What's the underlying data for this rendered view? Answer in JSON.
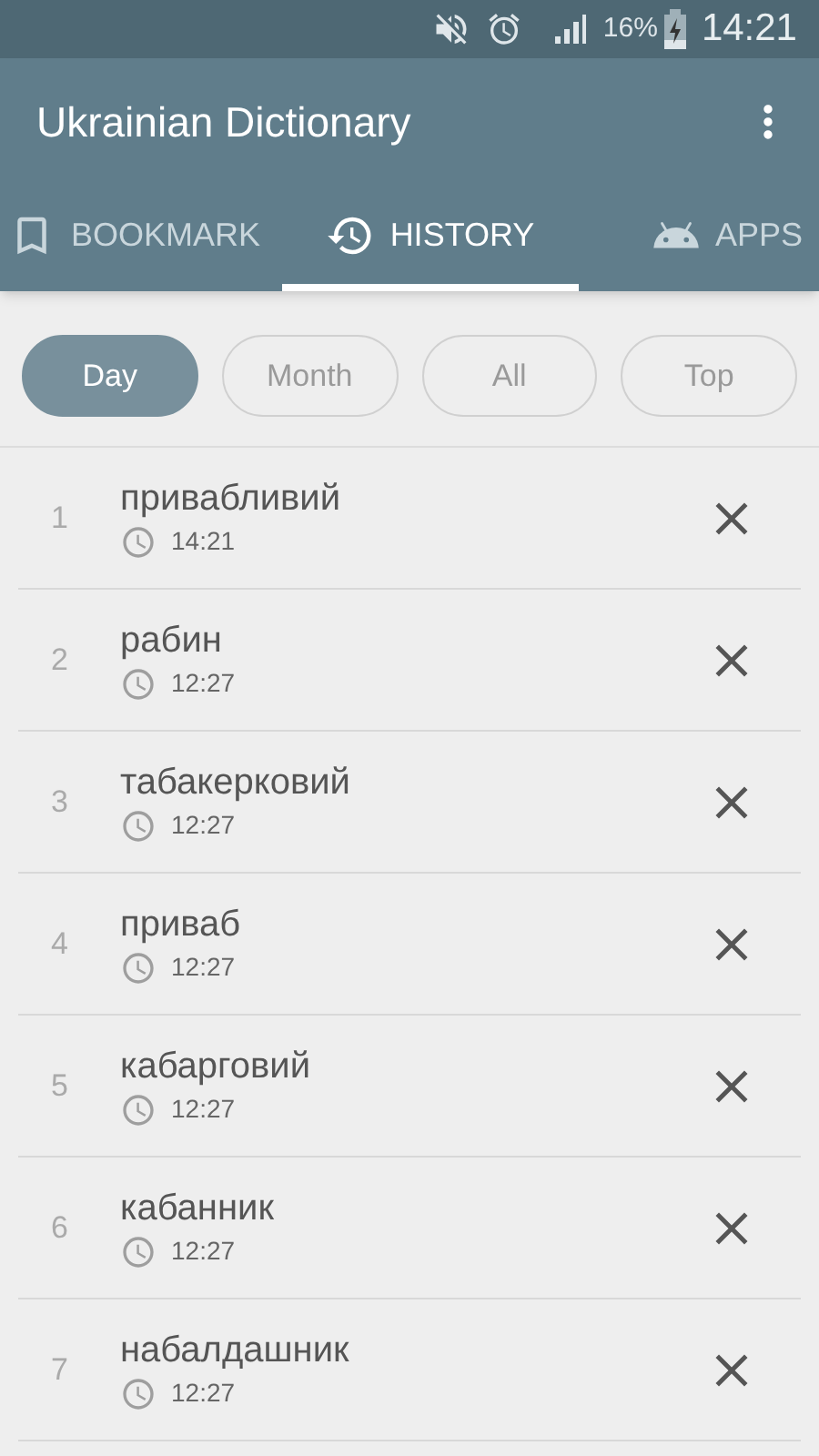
{
  "status_bar": {
    "battery": "16%",
    "time": "14:21"
  },
  "app_bar": {
    "title": "Ukrainian Dictionary"
  },
  "tabs": [
    {
      "label": "BOOKMARK",
      "kind": "bookmark",
      "selected": false
    },
    {
      "label": "HISTORY",
      "kind": "history",
      "selected": true
    },
    {
      "label": "APPS",
      "kind": "apps",
      "selected": false
    }
  ],
  "filters": [
    {
      "label": "Day",
      "selected": true
    },
    {
      "label": "Month",
      "selected": false
    },
    {
      "label": "All",
      "selected": false
    },
    {
      "label": "Top",
      "selected": false
    }
  ],
  "history": [
    {
      "index": "1",
      "word": "привабливий",
      "time": "14:21"
    },
    {
      "index": "2",
      "word": "рабин",
      "time": "12:27"
    },
    {
      "index": "3",
      "word": "табакерковий",
      "time": "12:27"
    },
    {
      "index": "4",
      "word": "приваб",
      "time": "12:27"
    },
    {
      "index": "5",
      "word": "кабарговий",
      "time": "12:27"
    },
    {
      "index": "6",
      "word": "кабанник",
      "time": "12:27"
    },
    {
      "index": "7",
      "word": "набалдашник",
      "time": "12:27"
    }
  ]
}
